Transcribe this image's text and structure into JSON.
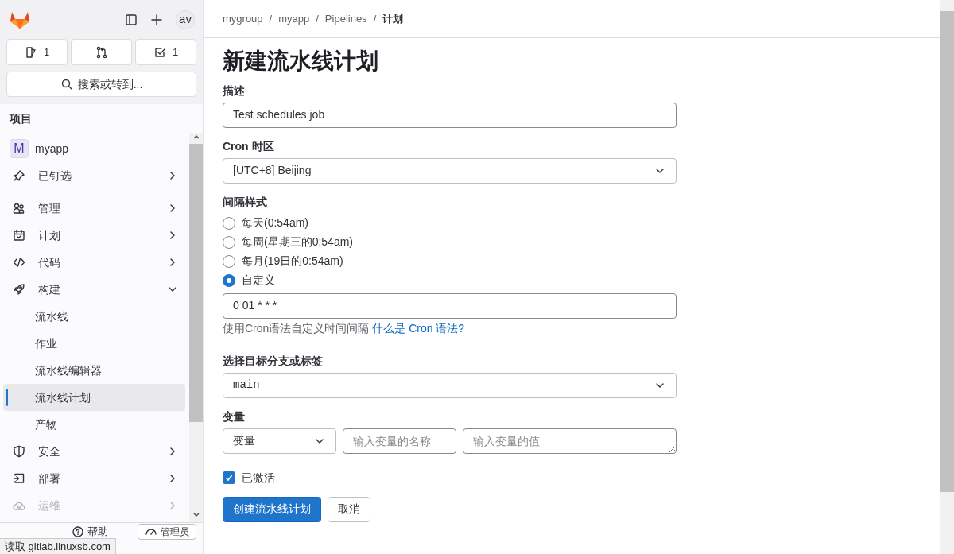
{
  "sidebar": {
    "avatar": "av",
    "top_buttons": [
      {
        "kind": "issues",
        "count": "1"
      },
      {
        "kind": "merge"
      },
      {
        "kind": "todo",
        "count": "1"
      }
    ],
    "search": "搜索或转到...",
    "section_title": "项目",
    "project": {
      "initial": "M",
      "name": "myapp"
    },
    "items": [
      {
        "kind": "pin",
        "label": "已钉选",
        "expanded": false,
        "dimmed": false
      },
      {
        "kind": "manage",
        "label": "管理",
        "expanded": false,
        "dimmed": false
      },
      {
        "kind": "plan",
        "label": "计划",
        "expanded": false,
        "dimmed": false
      },
      {
        "kind": "code",
        "label": "代码",
        "expanded": false,
        "dimmed": false
      },
      {
        "kind": "build",
        "label": "构建",
        "expanded": true,
        "dimmed": false,
        "children": [
          {
            "label": "流水线",
            "selected": false
          },
          {
            "label": "作业",
            "selected": false
          },
          {
            "label": "流水线编辑器",
            "selected": false
          },
          {
            "label": "流水线计划",
            "selected": true
          },
          {
            "label": "产物",
            "selected": false
          }
        ]
      },
      {
        "kind": "security",
        "label": "安全",
        "expanded": false,
        "dimmed": false
      },
      {
        "kind": "deploy",
        "label": "部署",
        "expanded": false,
        "dimmed": false
      },
      {
        "kind": "operate",
        "label": "运维",
        "expanded": false,
        "dimmed": true
      }
    ],
    "footer": {
      "help": "帮助",
      "admin": "管理员"
    }
  },
  "status_bar": "读取 gitlab.linuxsb.com",
  "breadcrumb": [
    "mygroup",
    "myapp",
    "Pipelines",
    "计划"
  ],
  "breadcrumb_separator": "/",
  "title": "新建流水线计划",
  "form": {
    "description": {
      "label": "描述",
      "value": "Test schedules job"
    },
    "timezone": {
      "label": "Cron 时区",
      "value": "[UTC+8] Beijing"
    },
    "interval": {
      "label": "间隔样式",
      "options": [
        {
          "label": "每天(0:54am)",
          "selected": false
        },
        {
          "label": "每周(星期三的0:54am)",
          "selected": false
        },
        {
          "label": "每月(19日的0:54am)",
          "selected": false
        },
        {
          "label": "自定义",
          "selected": true
        }
      ],
      "cron_value": "0 01 * * *",
      "help": "使用Cron语法自定义时间间隔",
      "help_link": "什么是 Cron 语法?"
    },
    "branch": {
      "label": "选择目标分支或标签",
      "value": "main"
    },
    "variables": {
      "label": "变量",
      "type": "变量",
      "key_placeholder": "输入变量的名称",
      "value_placeholder": "输入变量的值"
    },
    "active": {
      "label": "已激活",
      "checked": true
    },
    "submit": "创建流水线计划",
    "cancel": "取消"
  }
}
